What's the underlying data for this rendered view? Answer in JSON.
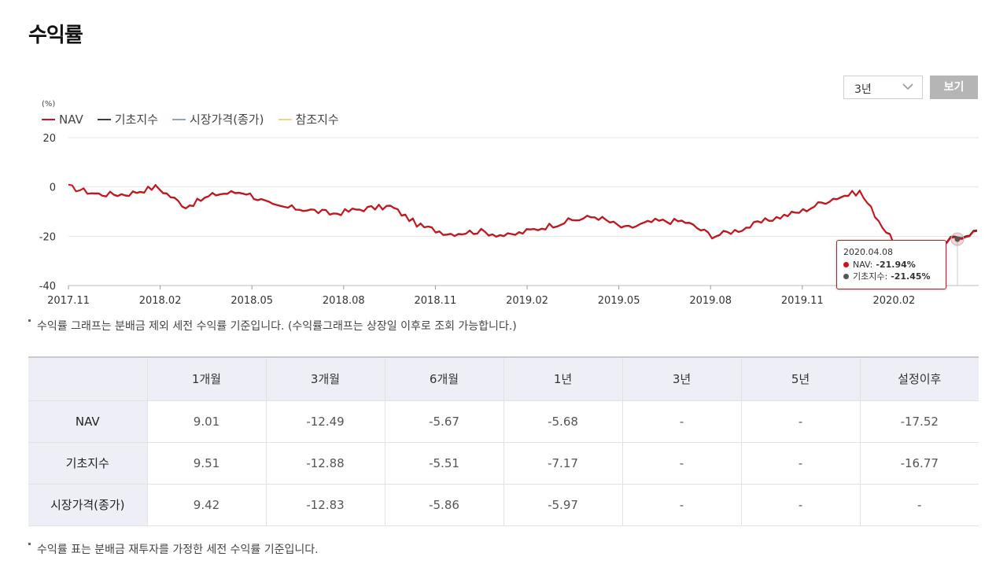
{
  "page": {
    "title": "수익률"
  },
  "controls": {
    "period_selected": "3년",
    "view_label": "보기"
  },
  "colors": {
    "nav": "#d0121a",
    "base_index": "#3b3b3b",
    "market_price": "#8fa4c8",
    "reference_index": "#f4d185",
    "header_bg": "#eeeef6",
    "button_bg": "#b5b5b5"
  },
  "chart_data": {
    "type": "line",
    "unit_label": "(%)",
    "legend": [
      "NAV",
      "기초지수",
      "시장가격(종가)",
      "참조지수"
    ],
    "ylim": [
      -40,
      20
    ],
    "y_ticks": [
      "20",
      "0",
      "-20",
      "-40"
    ],
    "x_ticks": [
      "2017.11",
      "2018.02",
      "2018.05",
      "2018.08",
      "2018.11",
      "2019.02",
      "2019.05",
      "2019.08",
      "2019.11",
      "2020.02"
    ],
    "grid": true,
    "series": [
      {
        "name": "NAV",
        "x": [
          "2017.11",
          "2017.12",
          "2018.01",
          "2018.02",
          "2018.03",
          "2018.04",
          "2018.05",
          "2018.06",
          "2018.07",
          "2018.08",
          "2018.09",
          "2018.10",
          "2018.11",
          "2018.12",
          "2019.01",
          "2019.02",
          "2019.03",
          "2019.04",
          "2019.05",
          "2019.06",
          "2019.07",
          "2019.08",
          "2019.09",
          "2019.10",
          "2019.11",
          "2019.12",
          "2019.01.20",
          "2020.02",
          "2020.03",
          "2020.03.23",
          "2020.04.08",
          "2020.04.20"
        ],
        "values": [
          0,
          -3,
          -3,
          0,
          -8,
          -3,
          -2,
          -8,
          -9,
          -11,
          -9,
          -8,
          -16,
          -19,
          -18,
          -20,
          -17,
          -14,
          -12,
          -17,
          -14,
          -14,
          -20,
          -17,
          -13,
          -10,
          -5,
          -2,
          -20,
          -34,
          -21.94,
          -18
        ]
      },
      {
        "name": "기초지수",
        "x": [
          "2017.11",
          "2017.12",
          "2018.01",
          "2018.02",
          "2018.03",
          "2018.04",
          "2018.05",
          "2018.06",
          "2018.07",
          "2018.08",
          "2018.09",
          "2018.10",
          "2018.11",
          "2018.12",
          "2019.01",
          "2019.02",
          "2019.03",
          "2019.04",
          "2019.05",
          "2019.06",
          "2019.07",
          "2019.08",
          "2019.09",
          "2019.10",
          "2019.11",
          "2019.12",
          "2019.01.20",
          "2020.02",
          "2020.03",
          "2020.03.23",
          "2020.04.08",
          "2020.04.20"
        ],
        "values": [
          0,
          -2.8,
          -2.8,
          0.2,
          -7.8,
          -2.8,
          -1.8,
          -7.8,
          -8.8,
          -10.8,
          -8.8,
          -7.8,
          -15.8,
          -18.8,
          -17.8,
          -19.8,
          -16.8,
          -13.8,
          -11.8,
          -16.8,
          -13.8,
          -13.8,
          -19.8,
          -16.8,
          -12.8,
          -9.8,
          -4.8,
          -1.8,
          -19.8,
          -33.5,
          -21.45,
          -17.6
        ]
      }
    ],
    "tooltip": {
      "date": "2020.04.08",
      "rows": [
        {
          "label": "NAV:",
          "value": "-21.94%"
        },
        {
          "label": "기초지수:",
          "value": "-21.45%"
        }
      ]
    }
  },
  "notes": {
    "chart_note": "수익률 그래프는 분배금 제외 세전 수익률 기준입니다. (수익률그래프는 상장일 이후로 조회 가능합니다.)",
    "table_note": "수익률 표는 분배금 재투자를 가정한 세전 수익률 기준입니다."
  },
  "table": {
    "headers": [
      "",
      "1개월",
      "3개월",
      "6개월",
      "1년",
      "3년",
      "5년",
      "설정이후"
    ],
    "rows": [
      {
        "label": "NAV",
        "cells": [
          "9.01",
          "-12.49",
          "-5.67",
          "-5.68",
          "-",
          "-",
          "-17.52"
        ]
      },
      {
        "label": "기초지수",
        "cells": [
          "9.51",
          "-12.88",
          "-5.51",
          "-7.17",
          "-",
          "-",
          "-16.77"
        ]
      },
      {
        "label": "시장가격(종가)",
        "cells": [
          "9.42",
          "-12.83",
          "-5.86",
          "-5.97",
          "-",
          "-",
          "-"
        ]
      }
    ]
  }
}
